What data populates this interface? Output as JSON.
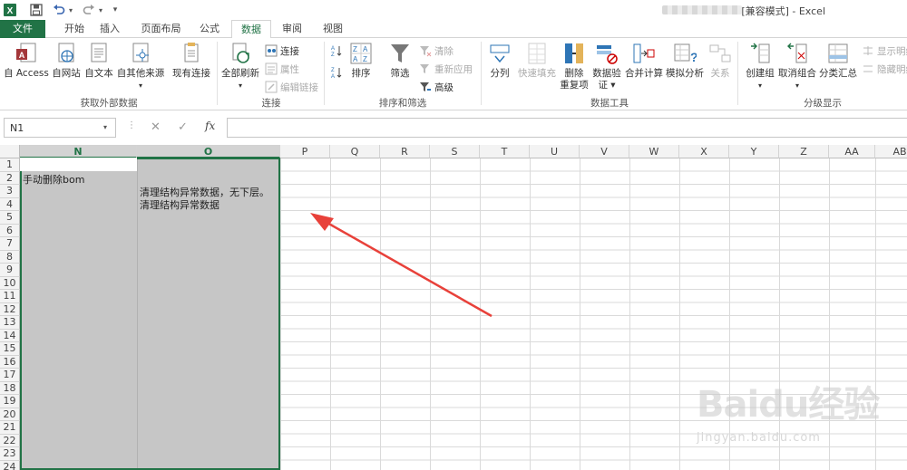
{
  "window": {
    "title": "[兼容模式] - Excel",
    "qat": {
      "save_icon": "save-icon",
      "undo_icon": "undo-icon",
      "redo_icon": "redo-icon",
      "more": "▾"
    }
  },
  "tabs": [
    {
      "label": "文件",
      "active": false
    },
    {
      "label": "开始",
      "active": false
    },
    {
      "label": "插入",
      "active": false
    },
    {
      "label": "页面布局",
      "active": false
    },
    {
      "label": "公式",
      "active": false
    },
    {
      "label": "数据",
      "active": true
    },
    {
      "label": "审阅",
      "active": false
    },
    {
      "label": "视图",
      "active": false
    }
  ],
  "ribbon": {
    "groups": {
      "external": "获取外部数据",
      "connections": "连接",
      "sort_filter": "排序和筛选",
      "data_tools": "数据工具",
      "outline": "分级显示"
    },
    "buttons": {
      "access": "自 Access",
      "web": "自网站",
      "text": "自文本",
      "other": "自其他来源",
      "existing": "现有连接",
      "refresh_all": "全部刷新",
      "connections": "连接",
      "properties": "属性",
      "edit_links": "编辑链接",
      "sort_az": "A↓Z",
      "sort_za": "Z↓A",
      "sort": "排序",
      "filter": "筛选",
      "clear": "清除",
      "reapply": "重新应用",
      "advanced": "高级",
      "text_to_columns": "分列",
      "flash_fill": "快速填充",
      "remove_dup_1": "删除",
      "remove_dup_2": "重复项",
      "validation_1": "数据验",
      "validation_2": "证 ▾",
      "consolidate": "合并计算",
      "what_if": "模拟分析",
      "relationships": "关系",
      "group": "创建组",
      "ungroup": "取消组合",
      "subtotal": "分类汇总",
      "show_detail": "显示明细",
      "hide_detail": "隐藏明细"
    }
  },
  "formula_bar": {
    "name_box": "N1",
    "fx": "fx",
    "value": ""
  },
  "sheet": {
    "columns": [
      "N",
      "O",
      "P",
      "Q",
      "R",
      "S",
      "T",
      "U",
      "V",
      "W",
      "X",
      "Y",
      "Z",
      "AA",
      "AB"
    ],
    "selected_columns": [
      "N",
      "O"
    ],
    "rows": [
      "1",
      "2",
      "3",
      "4",
      "5",
      "6",
      "7",
      "8",
      "9",
      "10",
      "11",
      "12",
      "13",
      "14",
      "15",
      "16",
      "17",
      "18",
      "19",
      "20",
      "21",
      "22",
      "23",
      "24"
    ],
    "cells": {
      "N2": "手动删除bom",
      "O3": "清理结构异常数据，无下层。",
      "O4": "清理结构异常数据"
    }
  },
  "watermark": {
    "main": "Baidu经验",
    "sub": "jingyan.baidu.com"
  },
  "colors": {
    "excel_green": "#217346",
    "selection": "#c6c6c6",
    "arrow_red": "#e8413a"
  }
}
